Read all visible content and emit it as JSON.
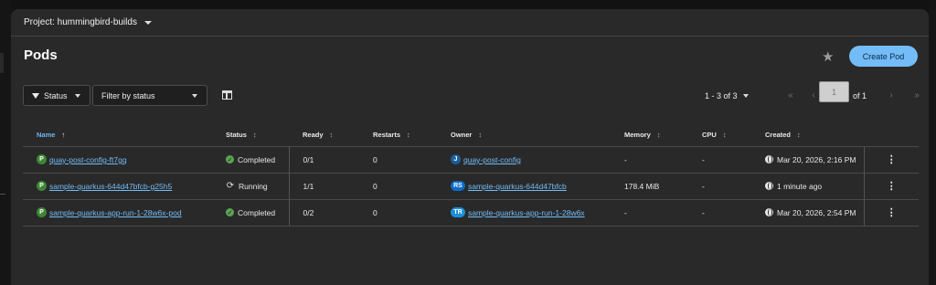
{
  "project": {
    "label": "Project: hummingbird-builds"
  },
  "page": {
    "title": "Pods",
    "create_button": "Create Pod"
  },
  "toolbar": {
    "filter_type": "Status",
    "filter_value": "Filter by status",
    "pagination_summary": "1 - 3 of 3",
    "current_page": "1",
    "page_of": "of 1"
  },
  "table": {
    "columns": [
      "Name",
      "Status",
      "Ready",
      "Restarts",
      "Owner",
      "Memory",
      "CPU",
      "Created"
    ],
    "rows": [
      {
        "name_badge": "P",
        "name": "quay-post-config-ft7gq",
        "status": "Completed",
        "status_kind": "completed",
        "ready": "0/1",
        "restarts": "0",
        "owner_badge": "J",
        "owner": "quay-post-config",
        "memory": "-",
        "cpu": "-",
        "created": "Mar 20, 2026, 2:16 PM"
      },
      {
        "name_badge": "P",
        "name": "sample-quarkus-644d47bfcb-g25h5",
        "status": "Running",
        "status_kind": "running",
        "ready": "1/1",
        "restarts": "0",
        "owner_badge": "RS",
        "owner": "sample-quarkus-644d47bfcb",
        "memory": "178.4 MiB",
        "cpu": "-",
        "created": "1 minute ago"
      },
      {
        "name_badge": "P",
        "name": "sample-quarkus-app-run-1-28w6x-pod",
        "status": "Completed",
        "status_kind": "completed",
        "ready": "0/2",
        "restarts": "0",
        "owner_badge": "TR",
        "owner": "sample-quarkus-app-run-1-28w6x",
        "memory": "-",
        "cpu": "-",
        "created": "Mar 20, 2026, 2:54 PM"
      }
    ]
  },
  "colors": {
    "accent": "#73bcf7",
    "success": "#5ba352",
    "background": "#292929"
  }
}
